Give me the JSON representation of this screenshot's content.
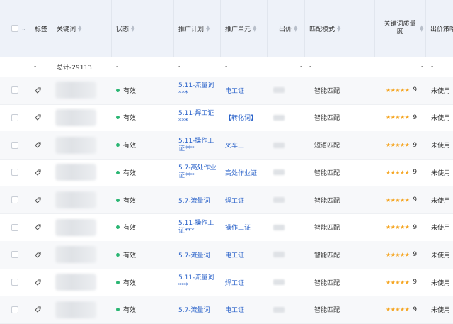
{
  "headers": {
    "tag": "标签",
    "keyword": "关键词",
    "status": "状态",
    "plan": "推广计划",
    "unit": "推广单元",
    "bid": "出价",
    "match": "匹配模式",
    "quality": "关键词质量度",
    "strategy": "出价策略"
  },
  "summary": {
    "dash": "-",
    "keyword": "总计-29113"
  },
  "rows": [
    {
      "status": "有效",
      "plan": "5.11-流量词***",
      "unit": "电工证",
      "match": "智能匹配",
      "score": "9",
      "strategy": "未使用"
    },
    {
      "status": "有效",
      "plan": "5.11-焊工证***",
      "unit": "【转化词】",
      "match": "智能匹配",
      "score": "9",
      "strategy": "未使用"
    },
    {
      "status": "有效",
      "plan": "5.11-操作工证***",
      "unit": "叉车工",
      "match": "短语匹配",
      "score": "9",
      "strategy": "未使用"
    },
    {
      "status": "有效",
      "plan": "5.7-高处作业证***",
      "unit": "高处作业证",
      "match": "智能匹配",
      "score": "9",
      "strategy": "未使用"
    },
    {
      "status": "有效",
      "plan": "5.7-流量词",
      "unit": "焊工证",
      "match": "智能匹配",
      "score": "9",
      "strategy": "未使用"
    },
    {
      "status": "有效",
      "plan": "5.11-操作工证***",
      "unit": "操作工证",
      "match": "智能匹配",
      "score": "9",
      "strategy": "未使用"
    },
    {
      "status": "有效",
      "plan": "5.7-流量词",
      "unit": "电工证",
      "match": "智能匹配",
      "score": "9",
      "strategy": "未使用"
    },
    {
      "status": "有效",
      "plan": "5.11-流量词***",
      "unit": "焊工证",
      "match": "智能匹配",
      "score": "9",
      "strategy": "未使用"
    },
    {
      "status": "有效",
      "plan": "5.7-流量词",
      "unit": "电工证",
      "match": "智能匹配",
      "score": "9",
      "strategy": "未使用"
    }
  ],
  "colors": {
    "accent": "#2a62c9",
    "status_ok": "#2bb673",
    "star": "#f5a623"
  },
  "icons": {
    "tag": "tag-icon",
    "sort": "sort-icon",
    "star": "star-icon"
  }
}
